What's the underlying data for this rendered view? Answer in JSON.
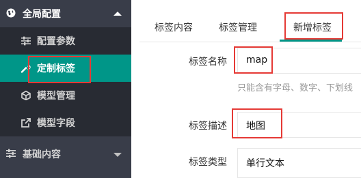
{
  "sidebar": {
    "group_global": {
      "label": "全局配置",
      "icon": "globe-icon",
      "expanded": true
    },
    "items": [
      {
        "label": "配置参数",
        "icon": "sliders-icon"
      },
      {
        "label": "定制标签",
        "icon": "wrench-icon",
        "active": true
      },
      {
        "label": "模型管理",
        "icon": "cube-icon"
      },
      {
        "label": "模型字段",
        "icon": "external-link-icon"
      }
    ],
    "group_basic": {
      "label": "基础内容",
      "icon": "sliders-icon",
      "expanded": false
    }
  },
  "tabs": [
    {
      "label": "标签内容"
    },
    {
      "label": "标签管理"
    },
    {
      "label": "新增标签",
      "active": true
    }
  ],
  "form": {
    "name_label": "标签名称",
    "name_value": "map",
    "name_hint": "只能含有字母、数字、下划线",
    "desc_label": "标签描述",
    "desc_value": "地图",
    "type_label": "标签类型",
    "type_value": "单行文本"
  },
  "colors": {
    "sidebar_bg": "#393d49",
    "submenu_bg": "#282b33",
    "accent": "#009688",
    "highlight": "#e53935"
  }
}
